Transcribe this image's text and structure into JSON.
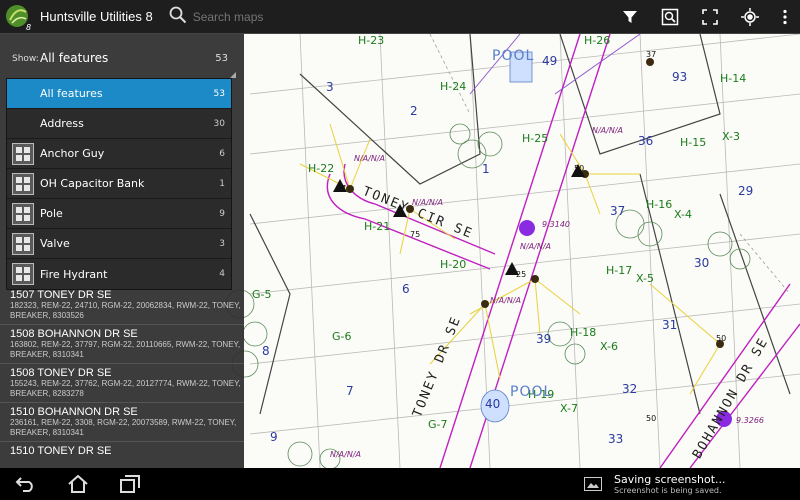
{
  "app": {
    "title": "Huntsville Utilities 8",
    "icon": "app-leaf-icon"
  },
  "search": {
    "placeholder": "Search maps",
    "value": ""
  },
  "toolbar": {
    "icons": [
      "filter-icon",
      "zoom-extent-icon",
      "fullscreen-icon",
      "locate-icon",
      "overflow-menu-icon"
    ]
  },
  "filter_panel": {
    "show_label": "Show:",
    "selected": "All features",
    "selected_count": "53",
    "options": [
      {
        "label": "All features",
        "count": "53",
        "selected": true,
        "icon": ""
      },
      {
        "label": "Address",
        "count": "30",
        "selected": false,
        "icon": ""
      },
      {
        "label": "Anchor Guy",
        "count": "6",
        "selected": false,
        "icon": "feature-grid-icon"
      },
      {
        "label": "OH Capacitor Bank",
        "count": "1",
        "selected": false,
        "icon": "feature-grid-icon"
      },
      {
        "label": "Pole",
        "count": "9",
        "selected": false,
        "icon": "feature-grid-icon"
      },
      {
        "label": "Valve",
        "count": "3",
        "selected": false,
        "icon": "feature-grid-icon"
      },
      {
        "label": "Fire Hydrant",
        "count": "4",
        "selected": false,
        "icon": "feature-grid-icon"
      }
    ]
  },
  "results": [
    {
      "title": "1507 TONEY DR SE",
      "sub": "182323, REM-22, 24710, RGM-22, 20062834, RWM-22, TONEY, BREAKER, 8303526"
    },
    {
      "title": "1508 BOHANNON DR SE",
      "sub": "163802, REM-22, 37797, RGM-22, 20110665, RWM-22, TONEY, BREAKER, 8310341"
    },
    {
      "title": "1508 TONEY DR SE",
      "sub": "155243, REM-22, 37762, RGM-22, 20127774, RWM-22, TONEY, BREAKER, 8283278"
    },
    {
      "title": "1510 BOHANNON DR SE",
      "sub": "236161, REM-22, 3308, RGM-22, 20073589, RWM-22, TONEY, BREAKER, 8310341"
    },
    {
      "title": "1510 TONEY DR SE",
      "sub": ""
    }
  ],
  "map": {
    "streets": [
      "TONEY CIR SE",
      "TONEY DR SE",
      "BOHANNON DR SE"
    ],
    "grid_labels": [
      "H-23",
      "H-26",
      "H-14",
      "H-24",
      "H-25",
      "H-15",
      "X-3",
      "H-22",
      "H-16",
      "X-4",
      "H-21",
      "H-20",
      "H-17",
      "X-5",
      "G-5",
      "H-18",
      "X-6",
      "G-6",
      "H-19",
      "X-7",
      "G-7"
    ],
    "lot_numbers": [
      "49",
      "3",
      "93",
      "2",
      "36",
      "1",
      "37",
      "29",
      "30",
      "6",
      "31",
      "39",
      "8",
      "32",
      "7",
      "40",
      "33",
      "9"
    ],
    "pool_labels": [
      "POOL",
      "POOL"
    ],
    "device_tags": [
      "N/A/N/A",
      "N/A/N/A",
      "N/A/N/A",
      "N/A/N/A",
      "N/A/N/A",
      "N/A/N/A"
    ],
    "node_ids": [
      "9.3140",
      "9.3266"
    ],
    "pole_counts": [
      "37",
      "75",
      "25",
      "50",
      "37",
      "50",
      "50"
    ],
    "node_color": "#8a2be2"
  },
  "navbar": {
    "icons": [
      "back-icon",
      "home-icon",
      "recent-apps-icon"
    ]
  },
  "toast": {
    "title": "Saving screenshot...",
    "subtitle": "Screenshot is being saved."
  }
}
